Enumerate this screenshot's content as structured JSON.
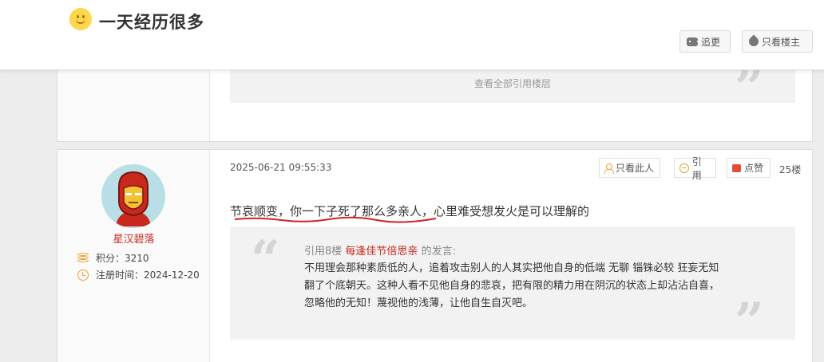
{
  "header": {
    "title": "一天经历很多",
    "reply_label": "追更",
    "only_owner_label": "只看楼主"
  },
  "prev_post": {
    "view_all_quotes": "查看全部引用楼层"
  },
  "post": {
    "author": {
      "name": "星汉碧落",
      "points": "积分：3210",
      "register": "注册时间：2024-12-20"
    },
    "datetime": "2025-06-21 09:55:33",
    "actions": {
      "only_this_user": "只看此人",
      "quote": "引用",
      "like": "点赞"
    },
    "floor": "25楼",
    "content": "节哀顺变，你一下子死了那么多亲人，心里难受想发火是可以理解的",
    "quote": {
      "prefix": "引用8楼",
      "quoted_user": "每逢佳节倍思亲",
      "suffix": "的发言:",
      "text": "不用理会那种素质低的人，追着攻击别人的人其实把他自身的低端 无聊 锱铢必较 狂妄无知翻了个底朝天。这种人看不见他自身的悲哀，把有限的精力用在阴沉的状态上却沾沾自喜，忽略他的无知！蔑视他的浅薄，让他自生自灭吧。"
    }
  },
  "colors": {
    "username_red": "#c8281e",
    "icon_orange": "#f0a030",
    "underline_red": "#d62020"
  },
  "icons": [
    "smile-emoji-icon",
    "chat-icon",
    "drop-icon",
    "user-icon",
    "bubble-icon",
    "thumb-icon",
    "coins-icon",
    "clock-icon",
    "quote-open-icon",
    "quote-close-icon"
  ]
}
